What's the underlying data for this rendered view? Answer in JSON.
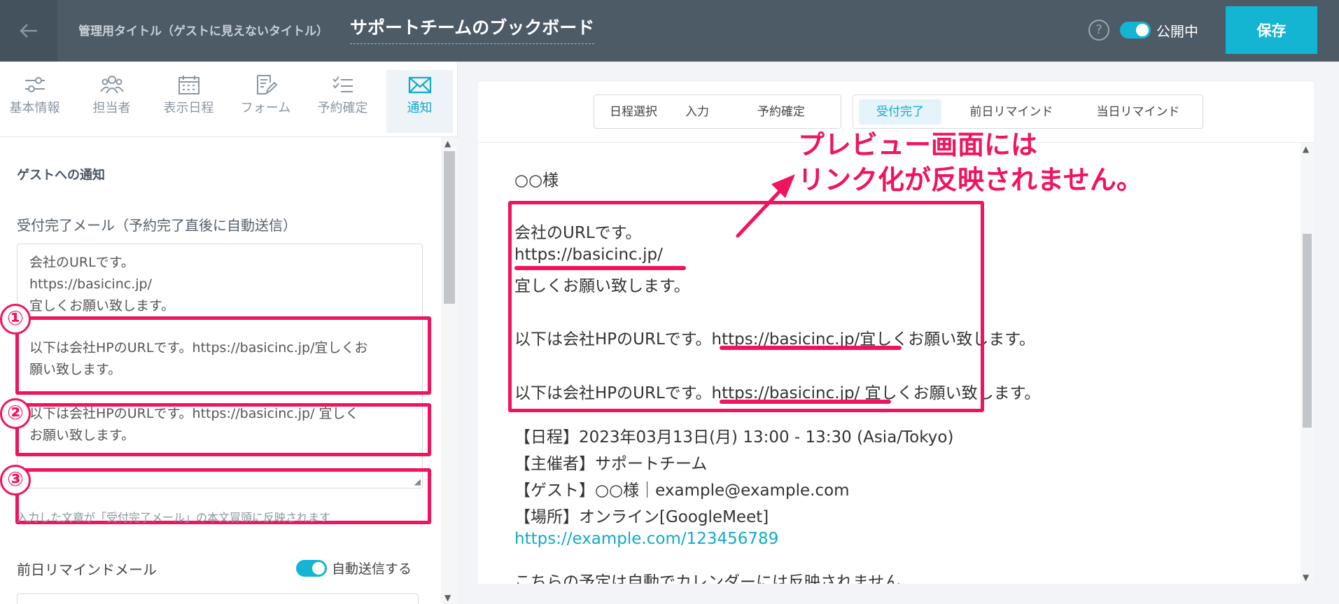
{
  "header": {
    "back_icon": "arrow-left-icon",
    "mgmt_label": "管理用タイトル（ゲストに見えないタイトル）",
    "board_title": "サポートチームのブックボード",
    "help": "?",
    "public_label": "公開中",
    "save_label": "保存"
  },
  "tabs": [
    {
      "label": "基本情報",
      "icon": "sliders-icon"
    },
    {
      "label": "担当者",
      "icon": "people-icon"
    },
    {
      "label": "表示日程",
      "icon": "calendar-icon"
    },
    {
      "label": "フォーム",
      "icon": "form-edit-icon"
    },
    {
      "label": "予約確定",
      "icon": "checklist-icon"
    },
    {
      "label": "通知",
      "icon": "envelope-icon",
      "active": true
    }
  ],
  "left": {
    "section_title": "ゲストへの通知",
    "field_label": "受付完了メール（予約完了直後に自動送信）",
    "textarea_lines": [
      "会社のURLです。",
      "https://basicinc.jp/",
      "宜しくお願い致します。",
      "以下は会社HPのURLです。https://basicinc.jp/宜しくお",
      "願い致します。",
      "以下は会社HPのURLです。https://basicinc.jp/ 宜しく",
      "お願い致します。"
    ],
    "circle_numbers": [
      "①",
      "②",
      "③"
    ],
    "hint": "入力した文章が「受付完了メール」の本文冒頭に反映されます",
    "remind_label": "前日リマインドメール",
    "auto_send_label": "自動送信する"
  },
  "preview": {
    "groups": [
      [
        "日程選択",
        "入力",
        "予約確定"
      ],
      [
        "受付完了",
        "前日リマインド",
        "当日リマインド"
      ]
    ],
    "active_tab": "受付完了",
    "lines": [
      "○○様",
      "会社のURLです。",
      "https://basicinc.jp/",
      "宜しくお願い致します。",
      "以下は会社HPのURLです。https://basicinc.jp/宜しくお願い致します。",
      "以下は会社HPのURLです。https://basicinc.jp/ 宜しくお願い致します。",
      "【日程】2023年03月13日(月) 13:00 - 13:30 (Asia/Tokyo)",
      "【主催者】サポートチーム",
      "【ゲスト】○○様｜example@example.com",
      "【場所】オンライン[GoogleMeet]",
      "https://example.com/123456789",
      "こちらの予定は自動でカレンダーには反映されません。"
    ],
    "annotation_line1": "プレビュー画面には",
    "annotation_line2": "リンク化が反映されません。"
  },
  "colors": {
    "accent": "#13b5d3",
    "header_bg": "#4d5b67",
    "highlight": "#f0145f"
  }
}
